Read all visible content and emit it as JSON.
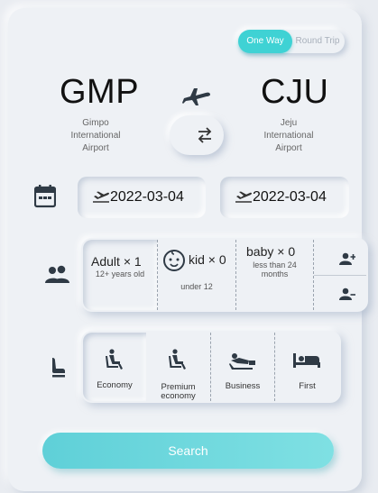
{
  "trip": {
    "one_way": "One Way",
    "round_trip": "Round Trip",
    "selected": "one_way"
  },
  "origin": {
    "code": "GMP",
    "name_lines": [
      "Gimpo",
      "International",
      "Airport"
    ]
  },
  "destination": {
    "code": "CJU",
    "name_lines": [
      "Jeju",
      "International",
      "Airport"
    ]
  },
  "dates": {
    "departure": "2022-03-04",
    "return": "2022-03-04"
  },
  "passengers": {
    "adult": {
      "label": "Adult",
      "count": "× 1",
      "note": "12+ years old"
    },
    "kid": {
      "label": "kid",
      "count": "× 0",
      "note": "under 12"
    },
    "baby": {
      "label": "baby",
      "count": "× 0",
      "note_lines": [
        "less than 24",
        "months"
      ]
    }
  },
  "cabins": [
    {
      "label_lines": [
        "Economy"
      ],
      "selected": true
    },
    {
      "label_lines": [
        "Premium",
        "economy"
      ],
      "selected": false
    },
    {
      "label_lines": [
        "Business"
      ],
      "selected": false
    },
    {
      "label_lines": [
        "First"
      ],
      "selected": false
    }
  ],
  "search_label": "Search",
  "icons": {
    "plane": "airplane-icon",
    "swap": "swap-arrows-icon",
    "calendar": "calendar-icon",
    "departure": "flight-takeoff-icon",
    "people": "people-icon",
    "baby": "baby-face-icon",
    "add_person": "person-add-icon",
    "remove_person": "person-remove-icon",
    "seat": "seat-icon"
  },
  "colors": {
    "accent": "#3fd2d4",
    "background": "#eef1f5",
    "search_gradient_start": "#5fd0d8",
    "search_gradient_end": "#7fe0e3"
  }
}
